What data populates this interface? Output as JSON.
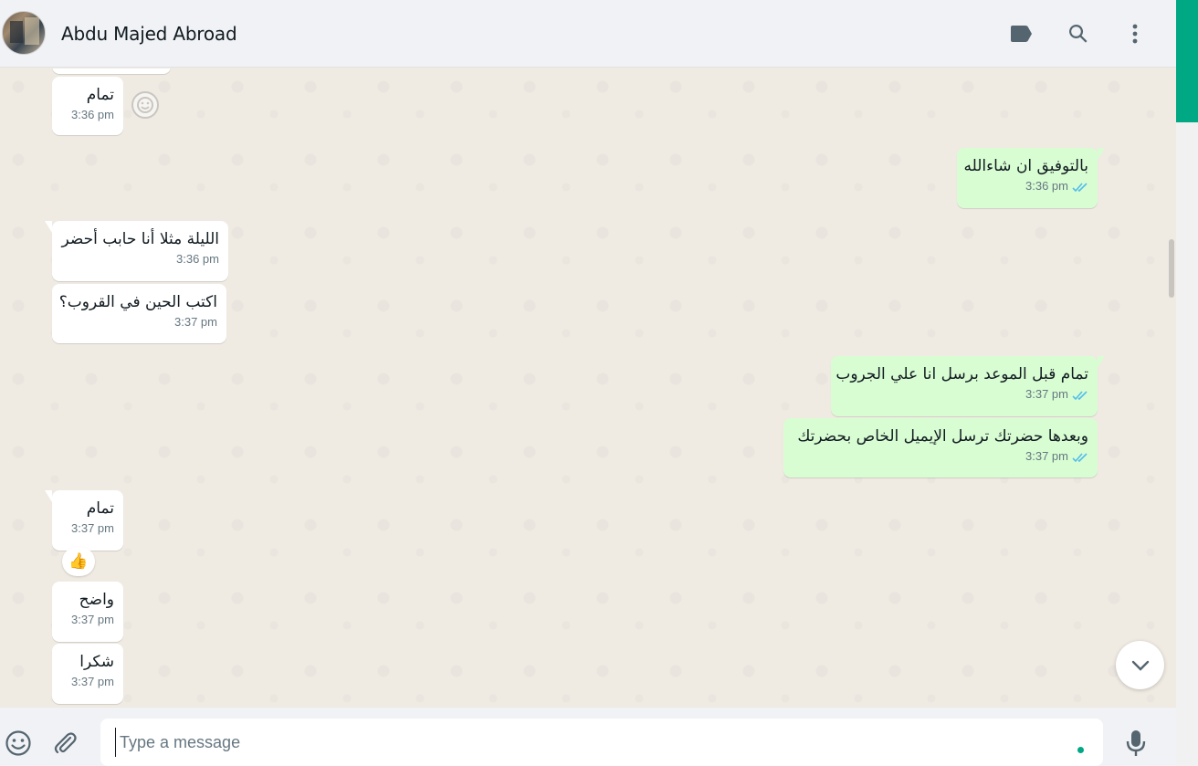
{
  "header": {
    "contact_name": "Abdu Majed Abroad",
    "icons": [
      "label-icon",
      "search-icon",
      "menu-icon"
    ]
  },
  "messages": [
    {
      "direction": "in",
      "text": "تمام",
      "time": "3:36 pm"
    },
    {
      "direction": "out",
      "text": "بالتوفيق ان شاءالله",
      "time": "3:36 pm",
      "status": "read"
    },
    {
      "direction": "in",
      "text": "الليلة مثلا أنا حابب أحضر",
      "time": "3:36 pm"
    },
    {
      "direction": "in",
      "text": "اكتب الحين في القروب؟",
      "time": "3:37 pm"
    },
    {
      "direction": "out",
      "text": "تمام قبل الموعد برسل انا علي الجروب",
      "time": "3:37 pm",
      "status": "read"
    },
    {
      "direction": "out",
      "text": "وبعدها حضرتك ترسل الإيميل الخاص بحضرتك",
      "time": "3:37 pm",
      "status": "read"
    },
    {
      "direction": "in",
      "text": "تمام",
      "time": "3:37 pm",
      "reaction": "👍"
    },
    {
      "direction": "in",
      "text": "واضح",
      "time": "3:37 pm"
    },
    {
      "direction": "in",
      "text": "شكرا",
      "time": "3:37 pm"
    }
  ],
  "composer": {
    "placeholder": "Type a message",
    "value": ""
  },
  "colors": {
    "accent": "#00a884",
    "outgoing_bubble": "#d9fdd3",
    "incoming_bubble": "#ffffff",
    "read_ticks": "#53bdeb",
    "chat_bg": "#efeae2"
  }
}
